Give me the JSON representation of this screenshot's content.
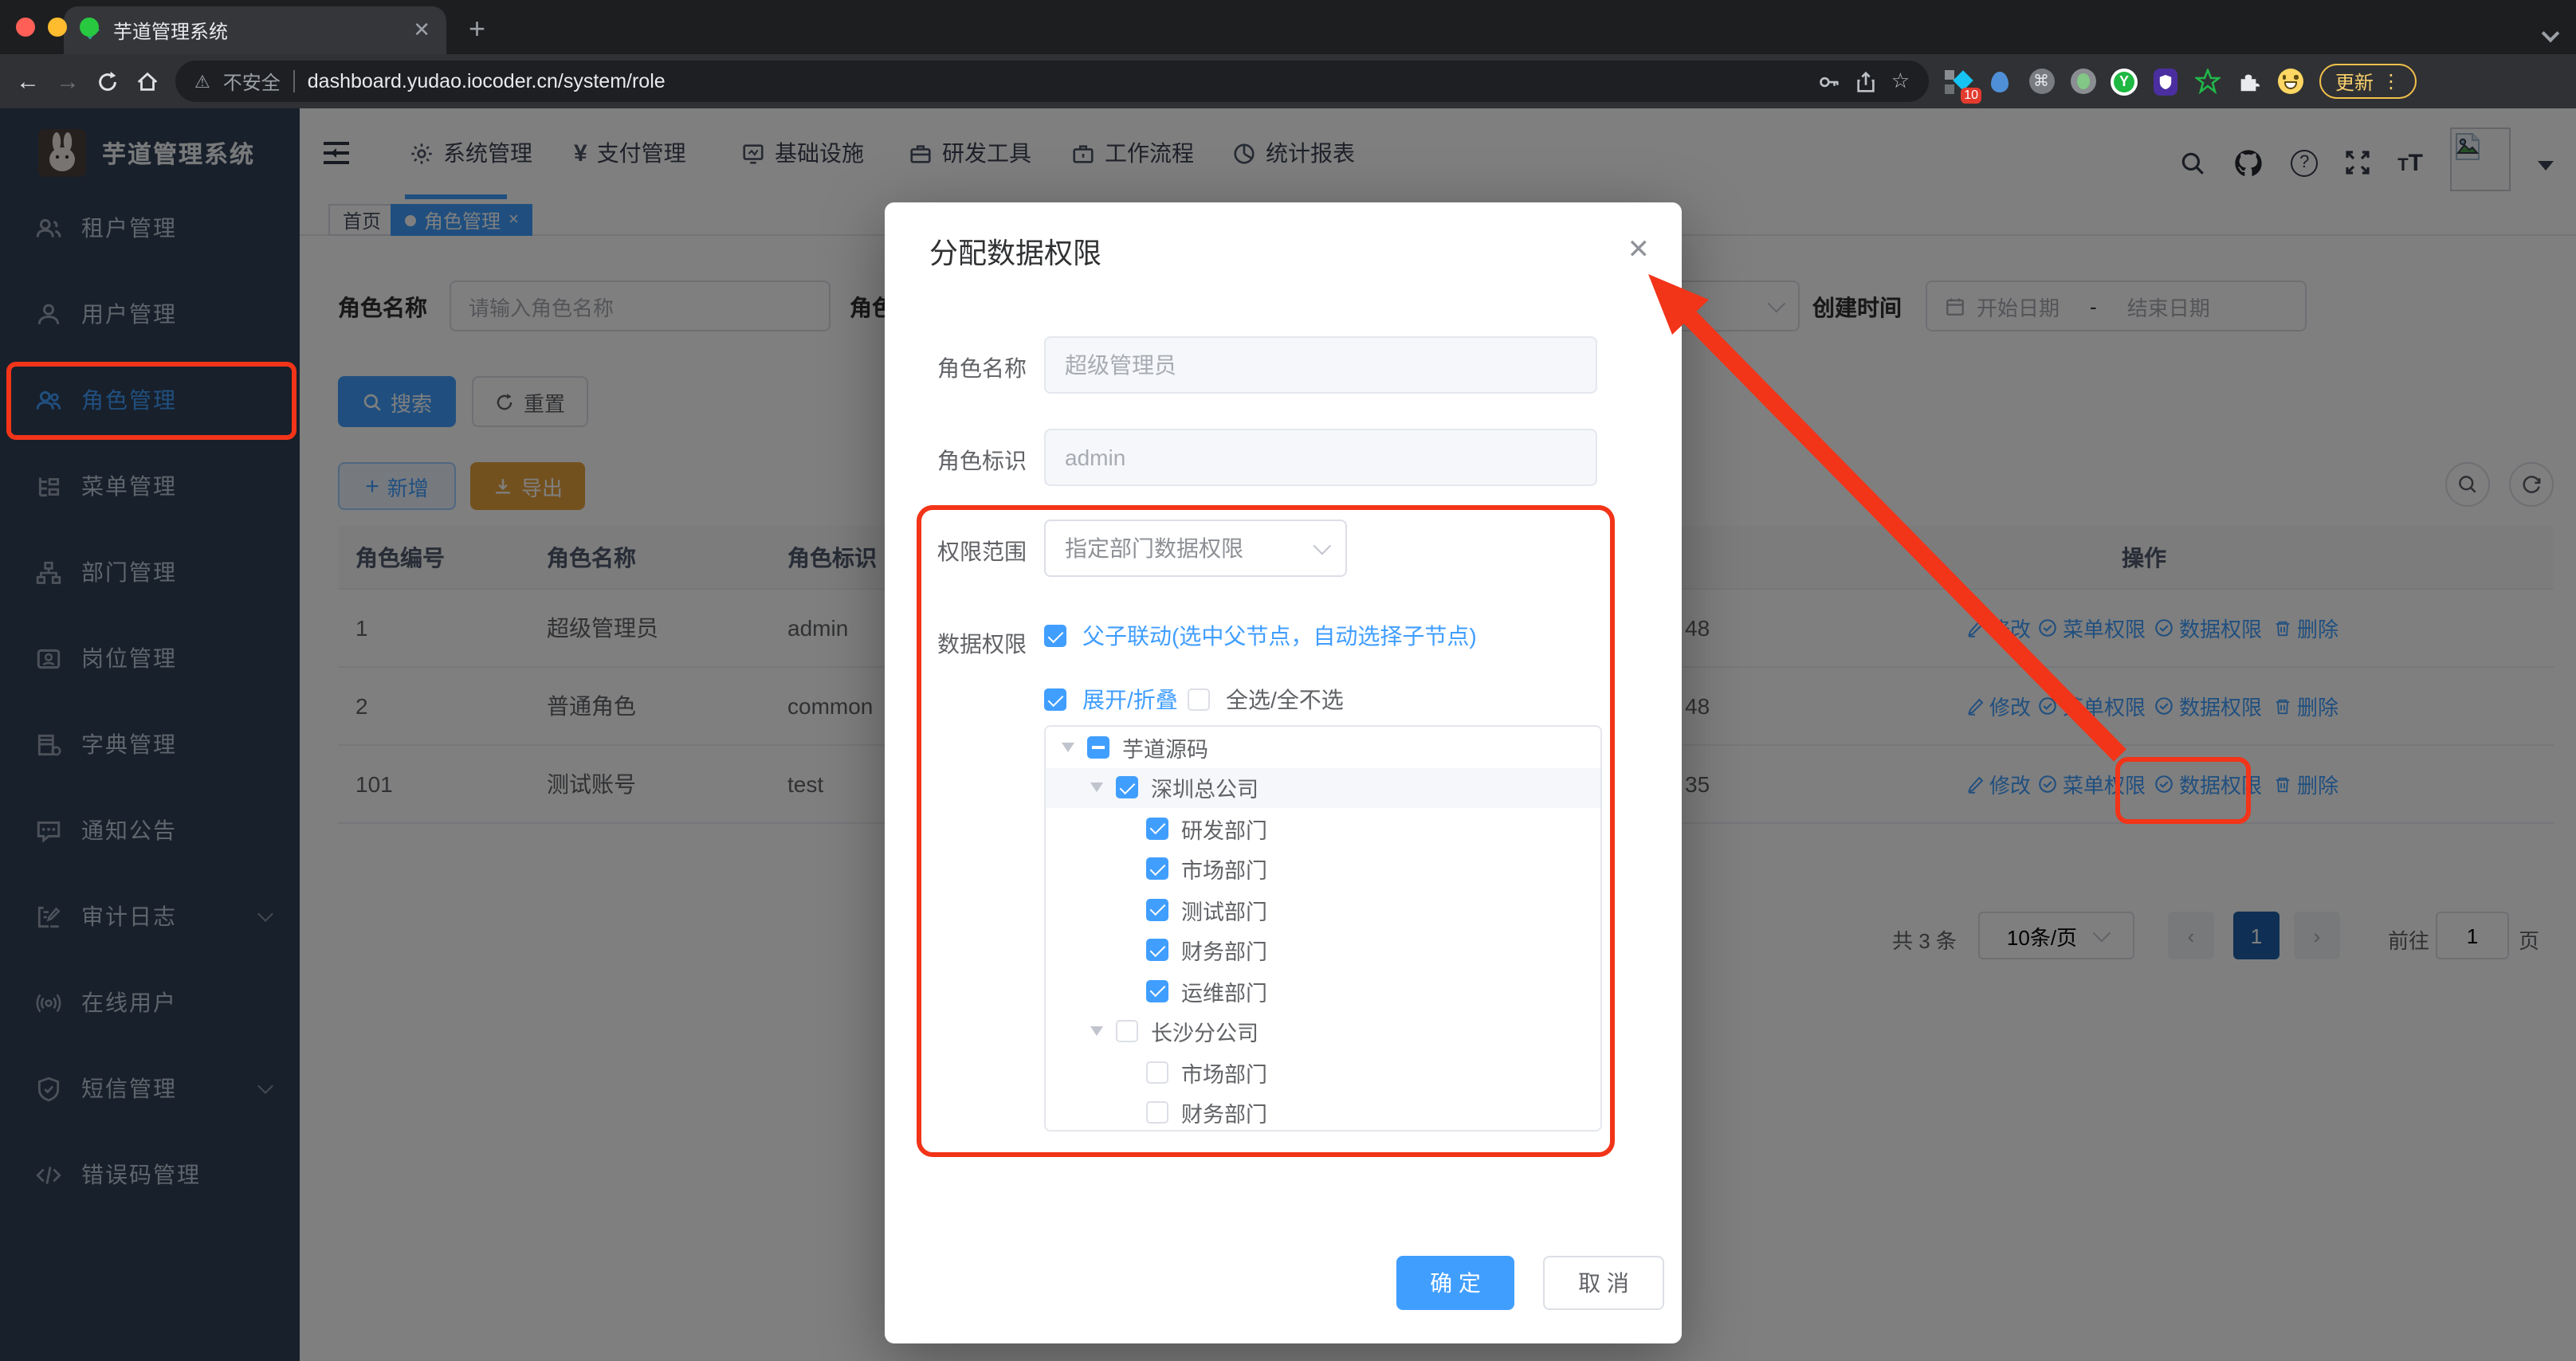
{
  "browser": {
    "tab_title": "芋道管理系统",
    "not_secure": "不安全",
    "url": "dashboard.yudao.iocoder.cn/system/role",
    "ext_badge": "10",
    "update_label": "更新"
  },
  "sidebar": {
    "title": "芋道管理系统",
    "items": [
      {
        "label": "租户管理"
      },
      {
        "label": "用户管理"
      },
      {
        "label": "角色管理"
      },
      {
        "label": "菜单管理"
      },
      {
        "label": "部门管理"
      },
      {
        "label": "岗位管理"
      },
      {
        "label": "字典管理"
      },
      {
        "label": "通知公告"
      },
      {
        "label": "审计日志"
      },
      {
        "label": "在线用户"
      },
      {
        "label": "短信管理"
      },
      {
        "label": "错误码管理"
      }
    ]
  },
  "topnav": {
    "items": [
      {
        "label": "系统管理"
      },
      {
        "label": "支付管理"
      },
      {
        "label": "基础设施"
      },
      {
        "label": "研发工具"
      },
      {
        "label": "工作流程"
      },
      {
        "label": "统计报表"
      }
    ]
  },
  "tags": {
    "home": "首页",
    "active": "角色管理"
  },
  "filters": {
    "role_name_label": "角色名称",
    "role_name_placeholder": "请输入角色名称",
    "role_key_label": "角色标识",
    "create_time_label": "创建时间",
    "start_placeholder": "开始日期",
    "range_sep": "-",
    "end_placeholder": "结束日期",
    "search": "搜索",
    "reset": "重置",
    "add": "新增",
    "export": "导出"
  },
  "table": {
    "headers": [
      "角色编号",
      "角色名称",
      "角色标识",
      "操作"
    ],
    "rows": [
      {
        "id": "1",
        "name": "超级管理员",
        "key": "admin",
        "time_tail": "48"
      },
      {
        "id": "2",
        "name": "普通角色",
        "key": "common",
        "time_tail": "48"
      },
      {
        "id": "101",
        "name": "测试账号",
        "key": "test",
        "time_tail": "35"
      }
    ],
    "actions": {
      "edit": "修改",
      "menu": "菜单权限",
      "data": "数据权限",
      "del": "删除"
    }
  },
  "pagination": {
    "total": "共 3 条",
    "page_size": "10条/页",
    "page": "1",
    "goto_label": "前往",
    "goto_value": "1",
    "unit": "页"
  },
  "dialog": {
    "title": "分配数据权限",
    "role_name_label": "角色名称",
    "role_name_value": "超级管理员",
    "role_key_label": "角色标识",
    "role_key_value": "admin",
    "scope_label": "权限范围",
    "scope_value": "指定部门数据权限",
    "perm_label": "数据权限",
    "linkage": "父子联动(选中父节点，自动选择子节点)",
    "expand_toggle": "展开/折叠",
    "select_all": "全选/全不选",
    "tree": [
      {
        "label": "芋道源码"
      },
      {
        "label": "深圳总公司"
      },
      {
        "label": "研发部门"
      },
      {
        "label": "市场部门"
      },
      {
        "label": "测试部门"
      },
      {
        "label": "财务部门"
      },
      {
        "label": "运维部门"
      },
      {
        "label": "长沙分公司"
      },
      {
        "label": "市场部门"
      },
      {
        "label": "财务部门"
      }
    ],
    "ok": "确 定",
    "cancel": "取 消"
  },
  "colors": {
    "accent": "#409eff",
    "warning": "#e6a23c",
    "annotation": "#f23419",
    "sidebar_bg": "#304156"
  }
}
